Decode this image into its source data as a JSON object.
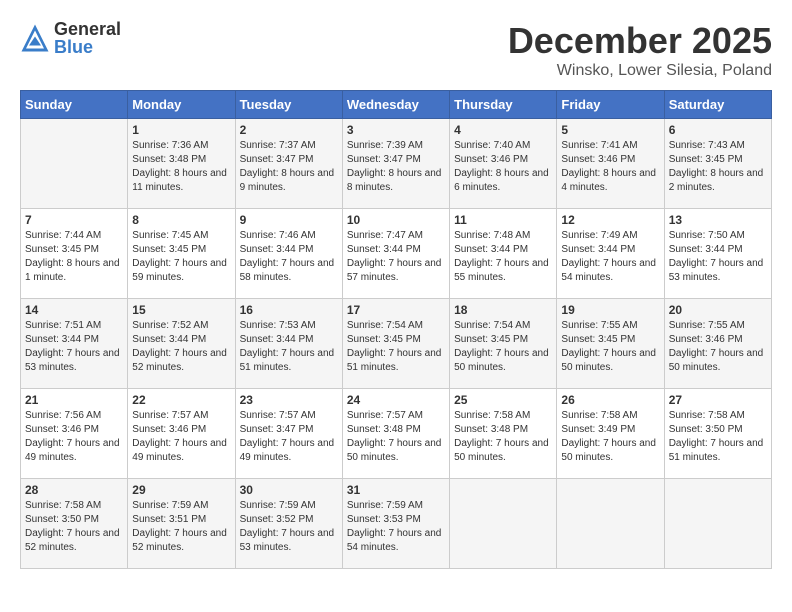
{
  "logo": {
    "general": "General",
    "blue": "Blue"
  },
  "header": {
    "month": "December 2025",
    "location": "Winsko, Lower Silesia, Poland"
  },
  "days_of_week": [
    "Sunday",
    "Monday",
    "Tuesday",
    "Wednesday",
    "Thursday",
    "Friday",
    "Saturday"
  ],
  "weeks": [
    [
      {
        "day": "",
        "sunrise": "",
        "sunset": "",
        "daylight": ""
      },
      {
        "day": "1",
        "sunrise": "Sunrise: 7:36 AM",
        "sunset": "Sunset: 3:48 PM",
        "daylight": "Daylight: 8 hours and 11 minutes."
      },
      {
        "day": "2",
        "sunrise": "Sunrise: 7:37 AM",
        "sunset": "Sunset: 3:47 PM",
        "daylight": "Daylight: 8 hours and 9 minutes."
      },
      {
        "day": "3",
        "sunrise": "Sunrise: 7:39 AM",
        "sunset": "Sunset: 3:47 PM",
        "daylight": "Daylight: 8 hours and 8 minutes."
      },
      {
        "day": "4",
        "sunrise": "Sunrise: 7:40 AM",
        "sunset": "Sunset: 3:46 PM",
        "daylight": "Daylight: 8 hours and 6 minutes."
      },
      {
        "day": "5",
        "sunrise": "Sunrise: 7:41 AM",
        "sunset": "Sunset: 3:46 PM",
        "daylight": "Daylight: 8 hours and 4 minutes."
      },
      {
        "day": "6",
        "sunrise": "Sunrise: 7:43 AM",
        "sunset": "Sunset: 3:45 PM",
        "daylight": "Daylight: 8 hours and 2 minutes."
      }
    ],
    [
      {
        "day": "7",
        "sunrise": "Sunrise: 7:44 AM",
        "sunset": "Sunset: 3:45 PM",
        "daylight": "Daylight: 8 hours and 1 minute."
      },
      {
        "day": "8",
        "sunrise": "Sunrise: 7:45 AM",
        "sunset": "Sunset: 3:45 PM",
        "daylight": "Daylight: 7 hours and 59 minutes."
      },
      {
        "day": "9",
        "sunrise": "Sunrise: 7:46 AM",
        "sunset": "Sunset: 3:44 PM",
        "daylight": "Daylight: 7 hours and 58 minutes."
      },
      {
        "day": "10",
        "sunrise": "Sunrise: 7:47 AM",
        "sunset": "Sunset: 3:44 PM",
        "daylight": "Daylight: 7 hours and 57 minutes."
      },
      {
        "day": "11",
        "sunrise": "Sunrise: 7:48 AM",
        "sunset": "Sunset: 3:44 PM",
        "daylight": "Daylight: 7 hours and 55 minutes."
      },
      {
        "day": "12",
        "sunrise": "Sunrise: 7:49 AM",
        "sunset": "Sunset: 3:44 PM",
        "daylight": "Daylight: 7 hours and 54 minutes."
      },
      {
        "day": "13",
        "sunrise": "Sunrise: 7:50 AM",
        "sunset": "Sunset: 3:44 PM",
        "daylight": "Daylight: 7 hours and 53 minutes."
      }
    ],
    [
      {
        "day": "14",
        "sunrise": "Sunrise: 7:51 AM",
        "sunset": "Sunset: 3:44 PM",
        "daylight": "Daylight: 7 hours and 53 minutes."
      },
      {
        "day": "15",
        "sunrise": "Sunrise: 7:52 AM",
        "sunset": "Sunset: 3:44 PM",
        "daylight": "Daylight: 7 hours and 52 minutes."
      },
      {
        "day": "16",
        "sunrise": "Sunrise: 7:53 AM",
        "sunset": "Sunset: 3:44 PM",
        "daylight": "Daylight: 7 hours and 51 minutes."
      },
      {
        "day": "17",
        "sunrise": "Sunrise: 7:54 AM",
        "sunset": "Sunset: 3:45 PM",
        "daylight": "Daylight: 7 hours and 51 minutes."
      },
      {
        "day": "18",
        "sunrise": "Sunrise: 7:54 AM",
        "sunset": "Sunset: 3:45 PM",
        "daylight": "Daylight: 7 hours and 50 minutes."
      },
      {
        "day": "19",
        "sunrise": "Sunrise: 7:55 AM",
        "sunset": "Sunset: 3:45 PM",
        "daylight": "Daylight: 7 hours and 50 minutes."
      },
      {
        "day": "20",
        "sunrise": "Sunrise: 7:55 AM",
        "sunset": "Sunset: 3:46 PM",
        "daylight": "Daylight: 7 hours and 50 minutes."
      }
    ],
    [
      {
        "day": "21",
        "sunrise": "Sunrise: 7:56 AM",
        "sunset": "Sunset: 3:46 PM",
        "daylight": "Daylight: 7 hours and 49 minutes."
      },
      {
        "day": "22",
        "sunrise": "Sunrise: 7:57 AM",
        "sunset": "Sunset: 3:46 PM",
        "daylight": "Daylight: 7 hours and 49 minutes."
      },
      {
        "day": "23",
        "sunrise": "Sunrise: 7:57 AM",
        "sunset": "Sunset: 3:47 PM",
        "daylight": "Daylight: 7 hours and 49 minutes."
      },
      {
        "day": "24",
        "sunrise": "Sunrise: 7:57 AM",
        "sunset": "Sunset: 3:48 PM",
        "daylight": "Daylight: 7 hours and 50 minutes."
      },
      {
        "day": "25",
        "sunrise": "Sunrise: 7:58 AM",
        "sunset": "Sunset: 3:48 PM",
        "daylight": "Daylight: 7 hours and 50 minutes."
      },
      {
        "day": "26",
        "sunrise": "Sunrise: 7:58 AM",
        "sunset": "Sunset: 3:49 PM",
        "daylight": "Daylight: 7 hours and 50 minutes."
      },
      {
        "day": "27",
        "sunrise": "Sunrise: 7:58 AM",
        "sunset": "Sunset: 3:50 PM",
        "daylight": "Daylight: 7 hours and 51 minutes."
      }
    ],
    [
      {
        "day": "28",
        "sunrise": "Sunrise: 7:58 AM",
        "sunset": "Sunset: 3:50 PM",
        "daylight": "Daylight: 7 hours and 52 minutes."
      },
      {
        "day": "29",
        "sunrise": "Sunrise: 7:59 AM",
        "sunset": "Sunset: 3:51 PM",
        "daylight": "Daylight: 7 hours and 52 minutes."
      },
      {
        "day": "30",
        "sunrise": "Sunrise: 7:59 AM",
        "sunset": "Sunset: 3:52 PM",
        "daylight": "Daylight: 7 hours and 53 minutes."
      },
      {
        "day": "31",
        "sunrise": "Sunrise: 7:59 AM",
        "sunset": "Sunset: 3:53 PM",
        "daylight": "Daylight: 7 hours and 54 minutes."
      },
      {
        "day": "",
        "sunrise": "",
        "sunset": "",
        "daylight": ""
      },
      {
        "day": "",
        "sunrise": "",
        "sunset": "",
        "daylight": ""
      },
      {
        "day": "",
        "sunrise": "",
        "sunset": "",
        "daylight": ""
      }
    ]
  ]
}
